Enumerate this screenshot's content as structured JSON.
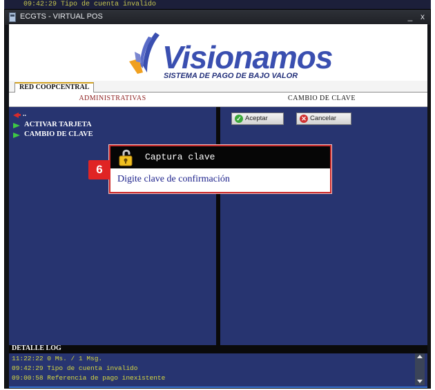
{
  "behind_window": {
    "log_line": "09:42:29 Tipo de cuenta invalido"
  },
  "window": {
    "title": "ECGTS - VIRTUAL POS",
    "minimize_glyph": "_",
    "close_glyph": "x"
  },
  "logo": {
    "wordmark": "Visionamos",
    "tagline": "SISTEMA DE PAGO DE BAJO VALOR",
    "colors": {
      "primary": "#3a4fb0",
      "dark": "#222f7a",
      "accent": "#f0a020"
    }
  },
  "tabs": [
    {
      "label": "RED COOPCENTRAL",
      "selected": true
    }
  ],
  "left_panel": {
    "header": "ADMINISTRATIVAS",
    "back_label": "..",
    "items": [
      {
        "label": "ACTIVAR TARJETA",
        "icon": "green-flag-icon"
      },
      {
        "label": "CAMBIO DE CLAVE",
        "icon": "green-flag-icon"
      }
    ]
  },
  "right_panel": {
    "header": "CAMBIO DE CLAVE",
    "buttons": [
      {
        "label": "Aceptar",
        "icon": "check-icon",
        "color": "#3aa83a"
      },
      {
        "label": "Cancelar",
        "icon": "cancel-icon",
        "color": "#d03030"
      }
    ]
  },
  "popup": {
    "title": "Captura clave",
    "icon": "lock-icon",
    "message": "Digite clave de confirmación"
  },
  "step_badge": "6",
  "log": {
    "title": "DETALLE LOG",
    "lines": [
      "11:22:22 0 Ms. / 1 Msg.",
      "09:42:29 Tipo de cuenta invalido",
      "09:00:58 Referencia de pago inexistente"
    ]
  },
  "colors": {
    "panel_bg": "#273470",
    "log_text": "#d8d840",
    "popup_border": "#cc2a2a"
  }
}
